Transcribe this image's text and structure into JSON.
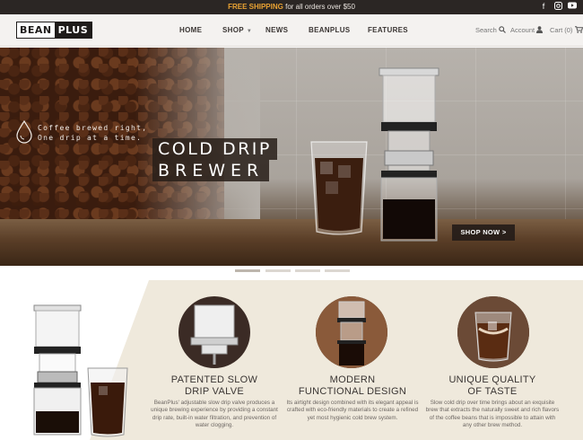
{
  "promo": {
    "strong": "FREE SHIPPING",
    "rest": " for all orders over $50"
  },
  "social": [
    {
      "icon": "facebook-icon",
      "glyph": "f"
    },
    {
      "icon": "instagram-icon",
      "glyph": "◘"
    },
    {
      "icon": "youtube-icon",
      "glyph": "▶"
    }
  ],
  "brand": {
    "part1": "BEAN",
    "part2": "PLUS"
  },
  "nav": {
    "items": [
      "HOME",
      "SHOP",
      "NEWS",
      "BEANPLUS",
      "FEATURES"
    ],
    "search_label": "Search",
    "account_label": "Account",
    "cart_label": "Cart (0)"
  },
  "hero": {
    "tagline_line1": "Coffee brewed right,",
    "tagline_line2": "One drip at a time.",
    "title_line1": "COLD DRIP",
    "title_line2": "BREWER",
    "cta": "SHOP NOW >"
  },
  "slider": {
    "count": 4,
    "active_index": 0
  },
  "features": [
    {
      "title_line1": "PATENTED SLOW",
      "title_line2": "DRIP VALVE",
      "desc": "BeanPlus' adjustable slow drip valve produces a unique brewing experience by providing a constant drip rate, built-in water filtration, and prevention of water clogging.",
      "image_icon": "drip-valve-image"
    },
    {
      "title_line1": "MODERN",
      "title_line2": "FUNCTIONAL DESIGN",
      "desc": "Its airtight design combined with its elegant appeal is crafted with eco-friendly materials to create a refined yet most hygienic cold brew system.",
      "image_icon": "brewer-design-image"
    },
    {
      "title_line1": "UNIQUE QUALITY",
      "title_line2": "OF TASTE",
      "desc": "Slow cold drip over time brings about an exquisite brew that extracts the naturally sweet and rich flavors of the coffee beans that is impossible to attain with any other brew method.",
      "image_icon": "coffee-taste-image"
    }
  ],
  "colors": {
    "accent": "#e9a233",
    "dark": "#2b2624",
    "band": "#efe9dc"
  }
}
